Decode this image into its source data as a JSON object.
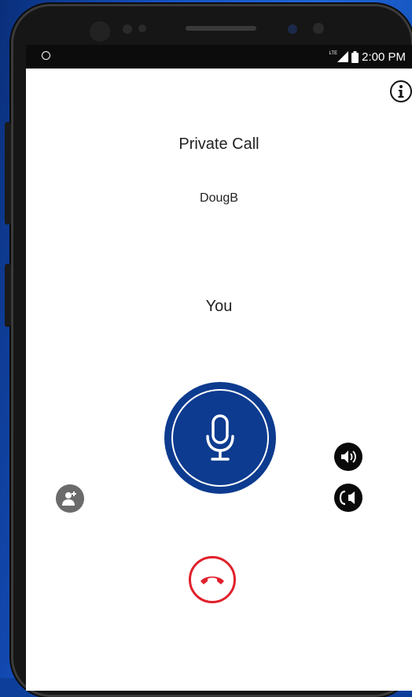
{
  "statusbar": {
    "time": "2:00 PM",
    "network_label": "LTE"
  },
  "call": {
    "title": "Private Call",
    "contact": "DougB",
    "talker": "You"
  },
  "icons": {
    "info": "info-icon",
    "mic": "microphone-icon",
    "add_user": "add-user-icon",
    "speaker": "speaker-icon",
    "earpiece": "earpiece-icon",
    "end_call": "end-call-icon"
  },
  "colors": {
    "accent": "#0d3b8f",
    "end_call": "#e0202a",
    "background": "#1550c0"
  }
}
